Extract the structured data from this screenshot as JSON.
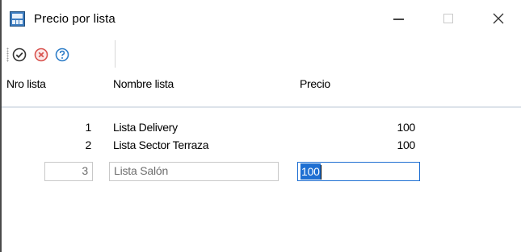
{
  "window": {
    "title": "Precio por lista",
    "controls": {
      "minimize": "minimize-icon",
      "maximize": "maximize-icon",
      "close": "close-icon"
    }
  },
  "toolbar": {
    "buttons": [
      {
        "name": "ok-button",
        "icon": "check-circle-icon",
        "color": "#333333"
      },
      {
        "name": "cancel-button",
        "icon": "x-circle-icon",
        "color": "#d9534f"
      },
      {
        "name": "help-button",
        "icon": "question-circle-icon",
        "color": "#2f7ec8"
      }
    ]
  },
  "table": {
    "columns": [
      "Nro lista",
      "Nombre lista",
      "Precio"
    ],
    "rows": [
      {
        "nro": "1",
        "nombre": "Lista Delivery",
        "precio": "100"
      },
      {
        "nro": "2",
        "nombre": "Lista Sector Terraza",
        "precio": "100"
      }
    ],
    "edit_row": {
      "nro": "3",
      "nombre": "Lista Salón",
      "precio": "100"
    }
  },
  "colors": {
    "accent": "#1e6fd2",
    "header_divider": "#dde3ea"
  }
}
